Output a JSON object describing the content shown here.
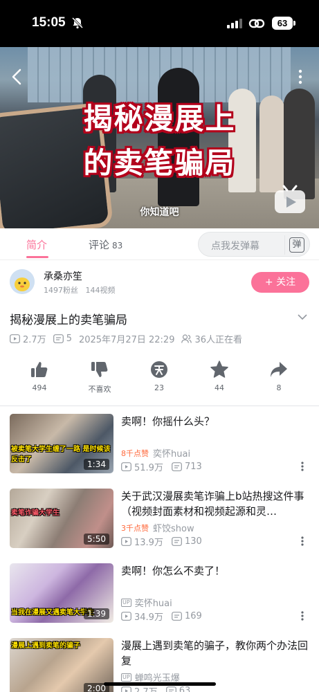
{
  "status_bar": {
    "time": "15:05",
    "battery": "63"
  },
  "video": {
    "title_line1": "揭秘漫展上",
    "title_line2": "的卖笔骗局",
    "subtitle": "你知道吧"
  },
  "tabs": {
    "intro": "简介",
    "comments": "评论",
    "comment_count": "83"
  },
  "danmu": {
    "placeholder": "点我发弹幕",
    "button": "弹"
  },
  "uploader": {
    "name": "承桑亦笙",
    "fans": "1497粉丝",
    "videos": "144视频",
    "follow": "+ 关注"
  },
  "video_info": {
    "title": "揭秘漫展上的卖笔骗局",
    "views": "2.7万",
    "danmaku": "5",
    "date": "2025年7月27日 22:29",
    "watching": "36人正在看"
  },
  "actions": {
    "like": "494",
    "dislike": "不喜欢",
    "coin": "23",
    "favorite": "44",
    "share": "8"
  },
  "related": [
    {
      "title": "卖啊！你摇什么头？",
      "badge": "8千点赞",
      "author": "奕怀huai",
      "views": "51.9万",
      "danmaku": "713",
      "duration": "1:34",
      "caption": "被卖笔大学生缠了一路 是时候该反击了"
    },
    {
      "title": "关于武汉漫展卖笔诈骗上b站热搜这件事（视频封面素材和视频起源和灵…",
      "badge": "3千点赞",
      "author": "虾饺show",
      "views": "13.9万",
      "danmaku": "130",
      "duration": "5:50",
      "caption": "卖笔诈骗大学生"
    },
    {
      "title": "卖啊！你怎么不卖了！",
      "badge": "",
      "author": "奕怀huai",
      "views": "34.9万",
      "danmaku": "169",
      "duration": "1:39",
      "caption": "当我在漫展又遇卖笔大学生"
    },
    {
      "title": "漫展上遇到卖笔的骗子，教你两个办法回复",
      "badge": "",
      "author": "蝉鸣光玉爆",
      "views": "2.7万",
      "danmaku": "63",
      "duration": "2:00",
      "caption": "漫展上遇到卖笔的骗子"
    }
  ]
}
